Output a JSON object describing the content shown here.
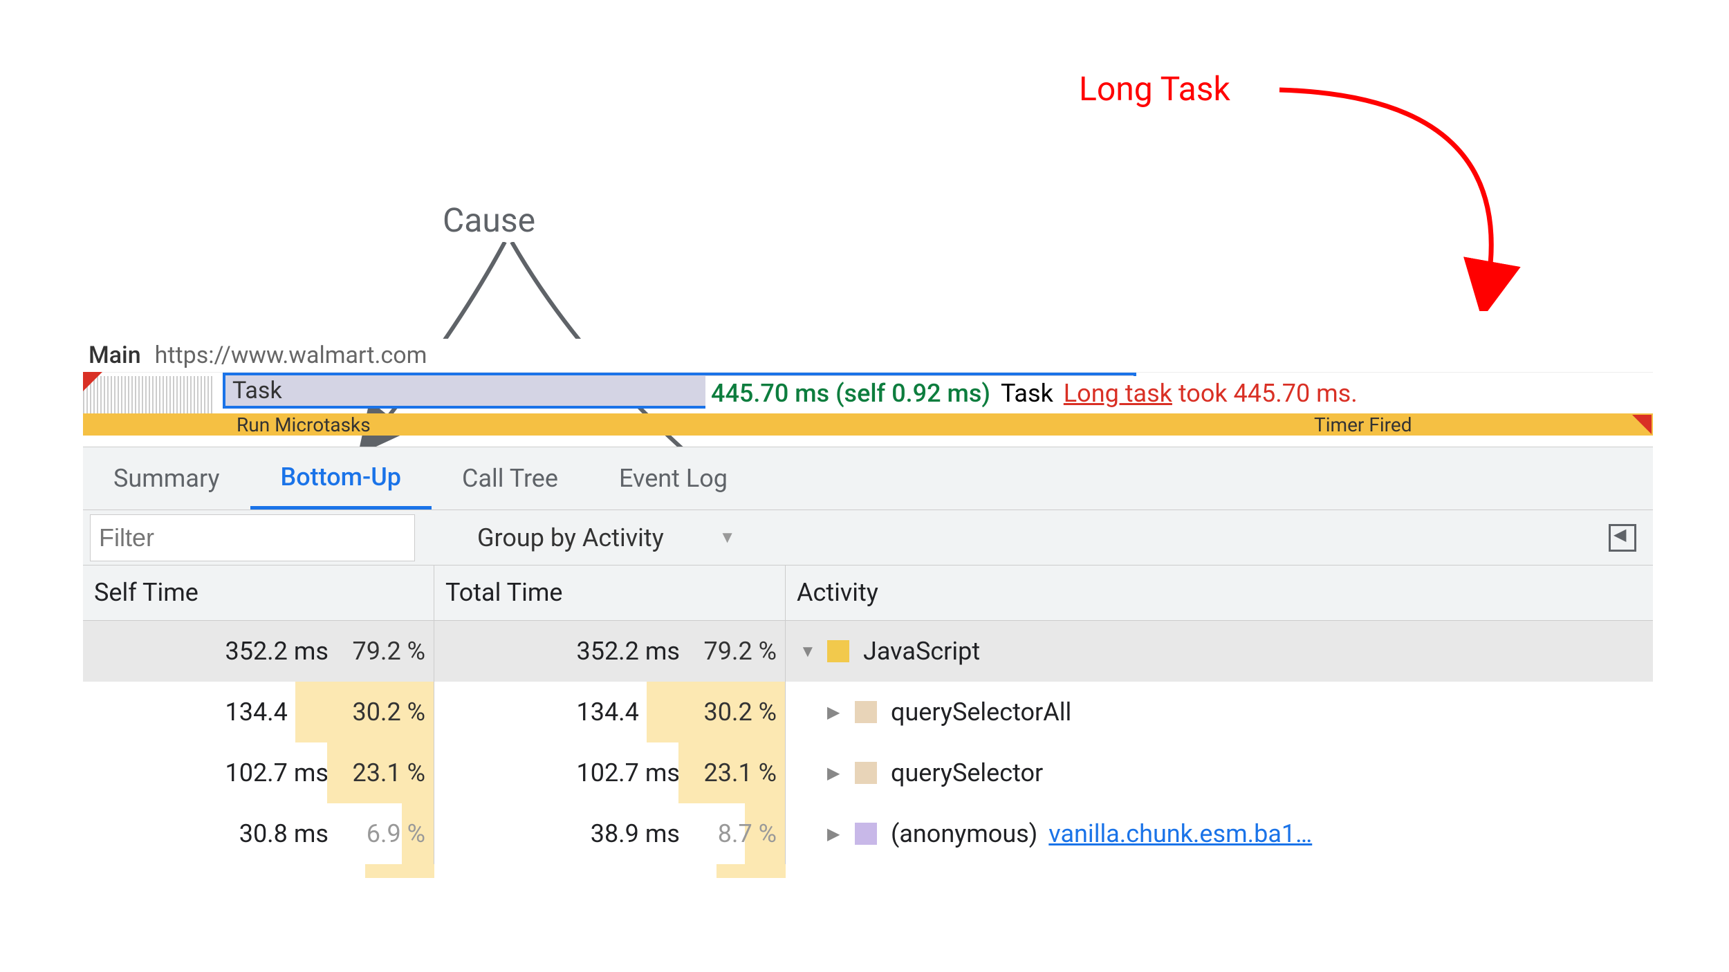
{
  "annotations": {
    "long_task": "Long Task",
    "cause": "Cause"
  },
  "timeline": {
    "thread_name": "Main",
    "thread_url": "https://www.walmart.com",
    "task_label": "Task",
    "tooltip_duration": "445.70 ms (self 0.92 ms)",
    "tooltip_type": "Task",
    "tooltip_link": "Long task",
    "tooltip_suffix": " took 445.70 ms.",
    "subtask_left": "Run Microtasks",
    "subtask_right": "Timer Fired"
  },
  "tabs": {
    "summary": "Summary",
    "bottom_up": "Bottom-Up",
    "call_tree": "Call Tree",
    "event_log": "Event Log"
  },
  "filter": {
    "placeholder": "Filter",
    "group_label": "Group by Activity"
  },
  "columns": {
    "self_time": "Self Time",
    "total_time": "Total Time",
    "activity": "Activity"
  },
  "rows": [
    {
      "self_time": "352.2 ms",
      "self_pct": "79.2 %",
      "total_time": "352.2 ms",
      "total_pct": "79.2 %",
      "toggle": "▼",
      "icon": "yellow",
      "name": "JavaScript",
      "highlighted": true,
      "indent": 0
    },
    {
      "self_time": "134.4 ms",
      "self_pct": "30.2 %",
      "total_time": "134.4 ms",
      "total_pct": "30.2 %",
      "toggle": "▶",
      "icon": "tan",
      "name": "querySelectorAll",
      "indent": 1
    },
    {
      "self_time": "102.7 ms",
      "self_pct": "23.1 %",
      "total_time": "102.7 ms",
      "total_pct": "23.1 %",
      "toggle": "▶",
      "icon": "tan",
      "name": "querySelector",
      "indent": 1
    },
    {
      "self_time": "30.8 ms",
      "self_pct": "6.9 %",
      "total_time": "38.9 ms",
      "total_pct": "8.7 %",
      "toggle": "▶",
      "icon": "purple",
      "name": "(anonymous)",
      "link": "vanilla.chunk.esm.ba1…",
      "indent": 1,
      "pct_gray": true
    }
  ]
}
